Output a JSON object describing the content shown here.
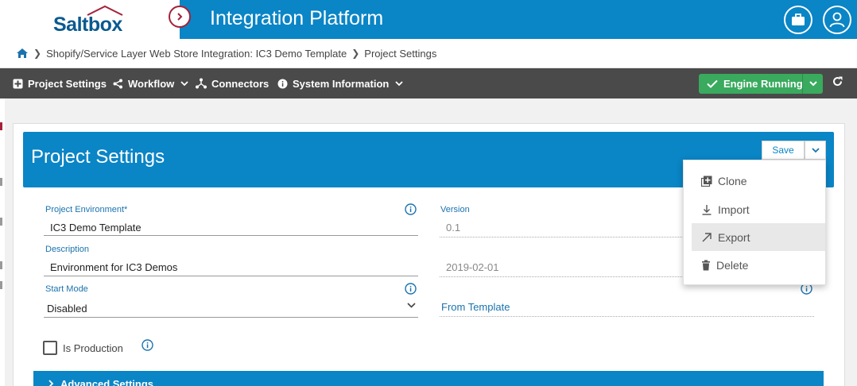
{
  "header": {
    "logo_text": "Saltbox",
    "app_title": "Integration Platform",
    "brand_color": "#0a85c6",
    "icons": [
      "chevron-right-icon",
      "briefcase-icon",
      "user-icon"
    ]
  },
  "breadcrumb": {
    "items": [
      "Shopify/Service Layer Web Store Integration: IC3 Demo Template",
      "Project Settings"
    ]
  },
  "toolbar": {
    "project_settings": "Project Settings",
    "workflow": "Workflow",
    "connectors": "Connectors",
    "system_information": "System Information",
    "engine_status": "Engine Running",
    "engine_color": "#3aaa5e"
  },
  "panel": {
    "title": "Project Settings",
    "save_label": "Save"
  },
  "menu": {
    "items": [
      "Clone",
      "Import",
      "Export",
      "Delete"
    ],
    "highlighted": "Export"
  },
  "form": {
    "project_environment": {
      "label": "Project Environment*",
      "value": "IC3 Demo Template"
    },
    "version": {
      "label": "Version",
      "value": "0.1"
    },
    "description": {
      "label": "Description",
      "value": "Environment for IC3 Demos"
    },
    "date": {
      "value": "2019-02-01"
    },
    "start_mode": {
      "label": "Start Mode",
      "value": "Disabled"
    },
    "from_template": {
      "value": "From Template"
    },
    "is_production": {
      "label": "Is Production",
      "checked": false
    },
    "advanced_settings": "Advanced Settings"
  }
}
